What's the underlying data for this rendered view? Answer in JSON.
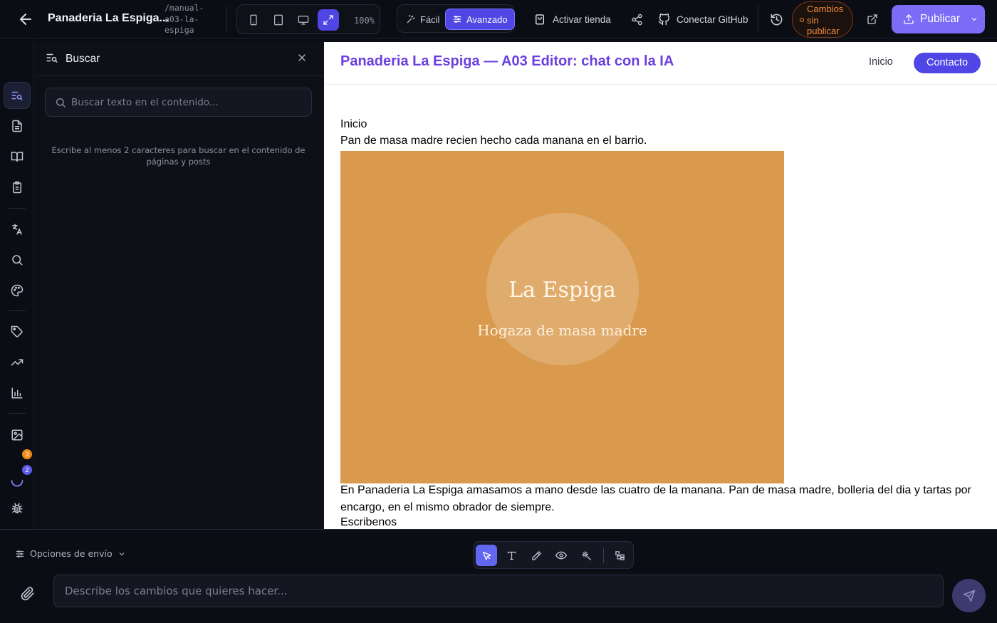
{
  "topbar": {
    "project_name": "Panaderia La Espiga...",
    "project_slug": "/manual-a03-la-espiga",
    "zoom": "100%",
    "device_buttons": [
      "mobile",
      "tablet",
      "desktop",
      "fullscreen"
    ],
    "active_device": "fullscreen",
    "mode_easy": "Fácil",
    "mode_advanced": "Avanzado",
    "active_mode": "Avanzado",
    "activate_store": "Activar tienda",
    "connect_github": "Conectar GitHub",
    "unpublished_changes": "Cambios sin publicar",
    "publish": "Publicar"
  },
  "rail": {
    "items": [
      "search",
      "pages",
      "blog",
      "forms",
      "translate",
      "seo",
      "theme",
      "tags",
      "growth",
      "analytics",
      "media",
      "tasks",
      "debug"
    ],
    "active": "search",
    "badge_a": "3",
    "badge_b": "2"
  },
  "search_panel": {
    "title": "Buscar",
    "placeholder": "Buscar texto en el contenido...",
    "hint": "Escribe al menos 2 caracteres para buscar en el contenido de páginas y posts"
  },
  "preview": {
    "site_title": "Panaderia La Espiga — A03 Editor: chat con la IA",
    "nav_link": "Inicio",
    "nav_cta": "Contacto",
    "heading": "Inicio",
    "tagline": "Pan de masa madre recien hecho cada manana en el barrio.",
    "hero_title": "La Espiga",
    "hero_subtitle": "Hogaza de masa madre",
    "body": "En Panaderia La Espiga amasamos a mano desde las cuatro de la manana. Pan de masa madre, bolleria del dia y tartas por encargo, en el mismo obrador de siempre.",
    "section_heading": "Escribenos"
  },
  "bottom": {
    "send_options": "Opciones de envío",
    "chat_placeholder": "Describe los cambios que quieres hacer...",
    "tools": [
      "select",
      "text",
      "draw",
      "preview",
      "magic",
      "structure"
    ],
    "active_tool": "select"
  },
  "colors": {
    "accent": "#4f46e5",
    "publish": "#7b6cf6",
    "unpublished": "#f08a3e",
    "site_title": "#6a3fe0",
    "hero_bg": "#d99a4e"
  }
}
